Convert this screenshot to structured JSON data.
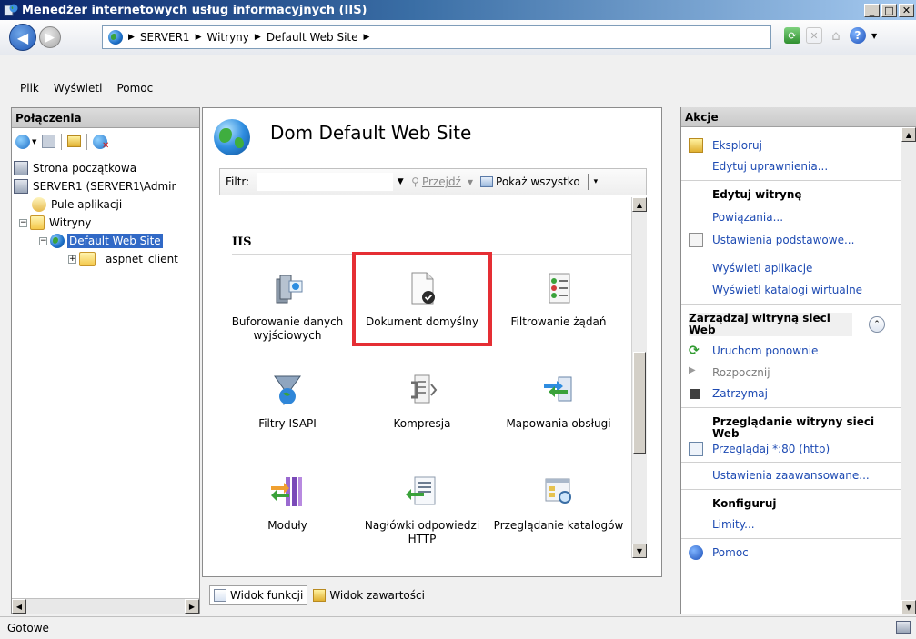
{
  "window": {
    "title": "Menedżer internetowych usług informacyjnych (IIS)"
  },
  "address": {
    "crumbs": [
      "SERVER1",
      "Witryny",
      "Default Web Site"
    ]
  },
  "menu": {
    "items": [
      "Plik",
      "Wyświetl",
      "Pomoc"
    ]
  },
  "connections": {
    "header": "Połączenia",
    "tree": [
      {
        "label": "Strona początkowa",
        "level": 0,
        "icon": "home-icon"
      },
      {
        "label": "SERVER1 (SERVER1\\Admir",
        "level": 0,
        "icon": "server-icon"
      },
      {
        "label": "Pule aplikacji",
        "level": 1,
        "icon": "app-pool-icon"
      },
      {
        "label": "Witryny",
        "level": 1,
        "icon": "folder-icon"
      },
      {
        "label": "Default Web Site",
        "level": 2,
        "icon": "globe-icon",
        "selected": true
      },
      {
        "label": "aspnet_client",
        "level": 3,
        "icon": "folder-icon"
      }
    ]
  },
  "center": {
    "title": "Dom Default Web Site",
    "filter": {
      "label": "Filtr:",
      "go": "Przejdź",
      "show_all": "Pokaż wszystko"
    },
    "group": "IIS",
    "features": [
      {
        "label": "Buforowanie danych wyjściowych",
        "icon": "output-cache-icon"
      },
      {
        "label": "Dokument domyślny",
        "icon": "default-document-icon"
      },
      {
        "label": "Filtrowanie żądań",
        "icon": "request-filtering-icon"
      },
      {
        "label": "Filtry ISAPI",
        "icon": "isapi-filters-icon"
      },
      {
        "label": "Kompresja",
        "icon": "compression-icon"
      },
      {
        "label": "Mapowania obsługi",
        "icon": "handler-mappings-icon"
      },
      {
        "label": "Moduły",
        "icon": "modules-icon"
      },
      {
        "label": "Nagłówki odpowiedzi HTTP",
        "icon": "http-headers-icon"
      },
      {
        "label": "Przeglądanie katalogów",
        "icon": "directory-browsing-icon"
      }
    ],
    "tabs": {
      "features_view": "Widok funkcji",
      "content_view": "Widok zawartości"
    }
  },
  "actions": {
    "header": "Akcje",
    "explore": "Eksploruj",
    "edit_permissions": "Edytuj uprawnienia...",
    "edit_site_title": "Edytuj witrynę",
    "bindings": "Powiązania...",
    "basic_settings": "Ustawienia podstawowe...",
    "view_apps": "Wyświetl aplikacje",
    "view_vdirs": "Wyświetl katalogi wirtualne",
    "manage_title": "Zarządzaj witryną sieci Web",
    "restart": "Uruchom ponownie",
    "start": "Rozpocznij",
    "stop": "Zatrzymaj",
    "browse_title": "Przeglądanie witryny sieci Web",
    "browse_80": "Przeglądaj *:80 (http)",
    "advanced": "Ustawienia zaawansowane...",
    "configure_title": "Konfiguruj",
    "limits": "Limity...",
    "help": "Pomoc"
  },
  "status": {
    "text": "Gotowe"
  }
}
